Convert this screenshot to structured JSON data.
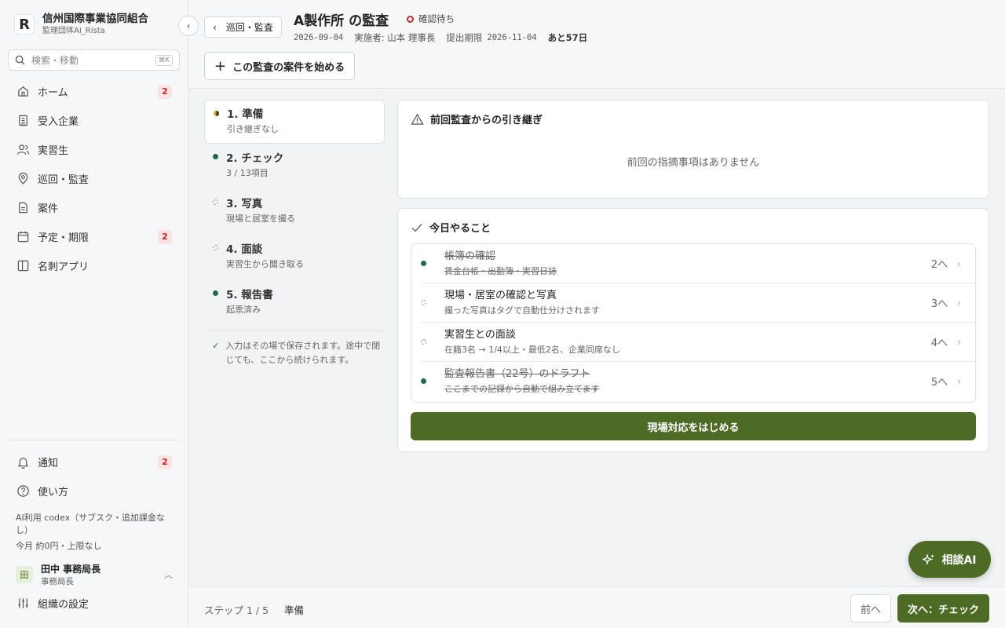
{
  "sidebar": {
    "org_name": "信州国際事業協同組合",
    "org_sub": "監理団体AI_Rista",
    "logo_letter": "R",
    "search": {
      "placeholder": "検索・移動",
      "shortcut": "⌘K"
    },
    "items": [
      {
        "label": "ホーム",
        "icon": "home-icon",
        "badge": "2"
      },
      {
        "label": "受入企業",
        "icon": "building-icon",
        "badge": ""
      },
      {
        "label": "実習生",
        "icon": "users-icon",
        "badge": ""
      },
      {
        "label": "巡回・監査",
        "icon": "map-pin-icon",
        "badge": ""
      },
      {
        "label": "案件",
        "icon": "document-icon",
        "badge": ""
      },
      {
        "label": "予定・期限",
        "icon": "calendar-icon",
        "badge": "2"
      },
      {
        "label": "名刺アプリ",
        "icon": "card-icon",
        "badge": ""
      }
    ],
    "bottom": [
      {
        "label": "通知",
        "icon": "bell-icon",
        "badge": "2"
      },
      {
        "label": "使い方",
        "icon": "help-icon",
        "badge": ""
      }
    ],
    "ai_usage": "AI利用 codex（サブスク・追加課金なし）",
    "ai_usage_sub": "今月 約0円・上限なし",
    "user": {
      "avatar": "田",
      "name": "田中 事務局長",
      "role": "事務局長"
    },
    "settings_label": "組織の設定"
  },
  "header": {
    "back_label": "巡回・監査",
    "title": "A製作所 の監査",
    "status": "確認待ち",
    "date": "2026-09-04",
    "performer": "実施者: 山本 理事長",
    "deadline_label": "提出期限",
    "deadline": "2026-11-04",
    "remaining": "あと57日",
    "start_button": "この監査の案件を始める"
  },
  "steps": [
    {
      "title": "1. 準備",
      "sub": "引き継ぎなし",
      "state": "current"
    },
    {
      "title": "2. チェック",
      "sub": "3 / 13項目",
      "state": "done"
    },
    {
      "title": "3. 写真",
      "sub": "現場と居室を撮る",
      "state": "todo"
    },
    {
      "title": "4. 面談",
      "sub": "実習生から聞き取る",
      "state": "todo"
    },
    {
      "title": "5. 報告書",
      "sub": "起票済み",
      "state": "done"
    }
  ],
  "save_note": "入力はその場で保存されます。途中で閉じても、ここから続けられます。",
  "carryover": {
    "title": "前回監査からの引き継ぎ",
    "empty": "前回の指摘事項はありません"
  },
  "today": {
    "title": "今日やること",
    "items": [
      {
        "title": "帳簿の確認",
        "sub": "賃金台帳・出勤簿・実習日誌",
        "go": "2へ",
        "done": true
      },
      {
        "title": "現場・居室の確認と写真",
        "sub": "撮った写真はタグで自動仕分けされます",
        "go": "3へ",
        "done": false
      },
      {
        "title": "実習生との面談",
        "sub": "在籍3名 → 1/4以上・最低2名、企業同席なし",
        "go": "4へ",
        "done": false
      },
      {
        "title": "監査報告書（22号）のドラフト",
        "sub": "ここまでの記録から自動で組み立てます",
        "go": "5へ",
        "done": true
      }
    ],
    "button": "現場対応をはじめる"
  },
  "fab_label": "相談AI",
  "footer": {
    "step": "ステップ 1 / 5",
    "step_name": "準備",
    "prev": "前へ",
    "next": "次へ：チェック"
  },
  "colors": {
    "primary": "#4e6b26",
    "done": "#1e6b4a",
    "badge_bg": "#fbe3e3",
    "badge_text": "#c62828"
  }
}
